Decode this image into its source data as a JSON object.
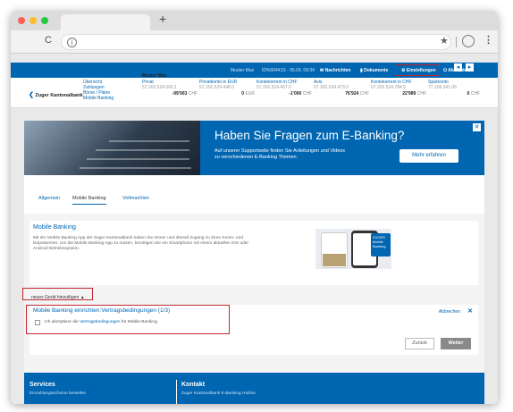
{
  "browser": {
    "new_tab": "+",
    "nav_back": "C",
    "nav_info": "i",
    "bookmark": "★",
    "menu": "⋮"
  },
  "topbar": {
    "user": "Muster Max",
    "session": "ID%00441S - 05.03. 09:34",
    "messages": "Nachrichten",
    "documents": "Dokumente",
    "settings": "Einstellungen",
    "logout": "Abmelden"
  },
  "accounts": {
    "logo_mark": "❮",
    "logo": "Zuger Kantonalbank",
    "links": [
      "Übersicht",
      "Zahlungen",
      "Börse / Pläne",
      "Mobile Banking"
    ],
    "owner": "Muster Max",
    "items": [
      {
        "name": "Privat",
        "iban": "57.202.524.566.1",
        "amount": "-99'003",
        "ccy": "CHF"
      },
      {
        "name": "Privatkonto in EUR",
        "iban": "57.202.524.448.0",
        "amount": "0",
        "ccy": "EUR"
      },
      {
        "name": "Kontokorrent in CHF",
        "iban": "57.202.524.467.0",
        "amount": "-1'000",
        "ccy": "CHF"
      },
      {
        "name": "Avis",
        "iban": "57.202.524.473.0",
        "amount": "76'924",
        "ccy": "CHF"
      },
      {
        "name": "Kontokorrent in CHF",
        "iban": "57.202.524.784.5",
        "amount": "22'989",
        "ccy": "CHF"
      },
      {
        "name": "Sparkonto",
        "iban": "77.106.341.06",
        "amount": "0",
        "ccy": "CHF"
      }
    ]
  },
  "banner": {
    "title": "Haben Sie Fragen zum E-Banking?",
    "subtitle_1": "Auf unserer Supportseite finden Sie Anleitungen und Videos",
    "subtitle_2": "zu verschiedenen E-Banking Themen.",
    "cta": "Mehr erfahren",
    "close": "✕"
  },
  "tabs": [
    "Allgemein",
    "Mobile Banking",
    "Vollmachten"
  ],
  "mobile_banking": {
    "title": "Mobile Banking",
    "text": "Mit der Mobile Banking App der Zuger Kantonalbank haben Sie immer und überall Zugang zu Ihren Konto- und Depotwerten. Um die Mobile Banking App zu nutzen, benötigen Sie ein Smartphone mit einem aktuellen iOS oder Android Betriebssystem.",
    "add_device": "neues Gerät hinzufügen ▲",
    "phone_label_1": "ZUGER",
    "phone_label_2": "Mobile",
    "phone_label_3": "Banking"
  },
  "setup": {
    "title": "Mobile Banking einrichten:Vertragsbedingungen (1/3)",
    "accept_prefix": "Ich akzeptiere die ",
    "accept_link": "Vertragsbedingungen",
    "accept_suffix": " für Mobile Banking.",
    "abort": "Abbrechen",
    "abort_x": "✕",
    "back": "Zurück",
    "next": "Weiter"
  },
  "footer": {
    "services": "Services",
    "services_sub": "Einzahlungsscheine bestellen",
    "contact": "Kontakt",
    "contact_sub": "Zuger Kantonalbank E-Banking Hotline"
  },
  "colors": {
    "brand": "#0066b2",
    "highlight": "#c0282f"
  }
}
